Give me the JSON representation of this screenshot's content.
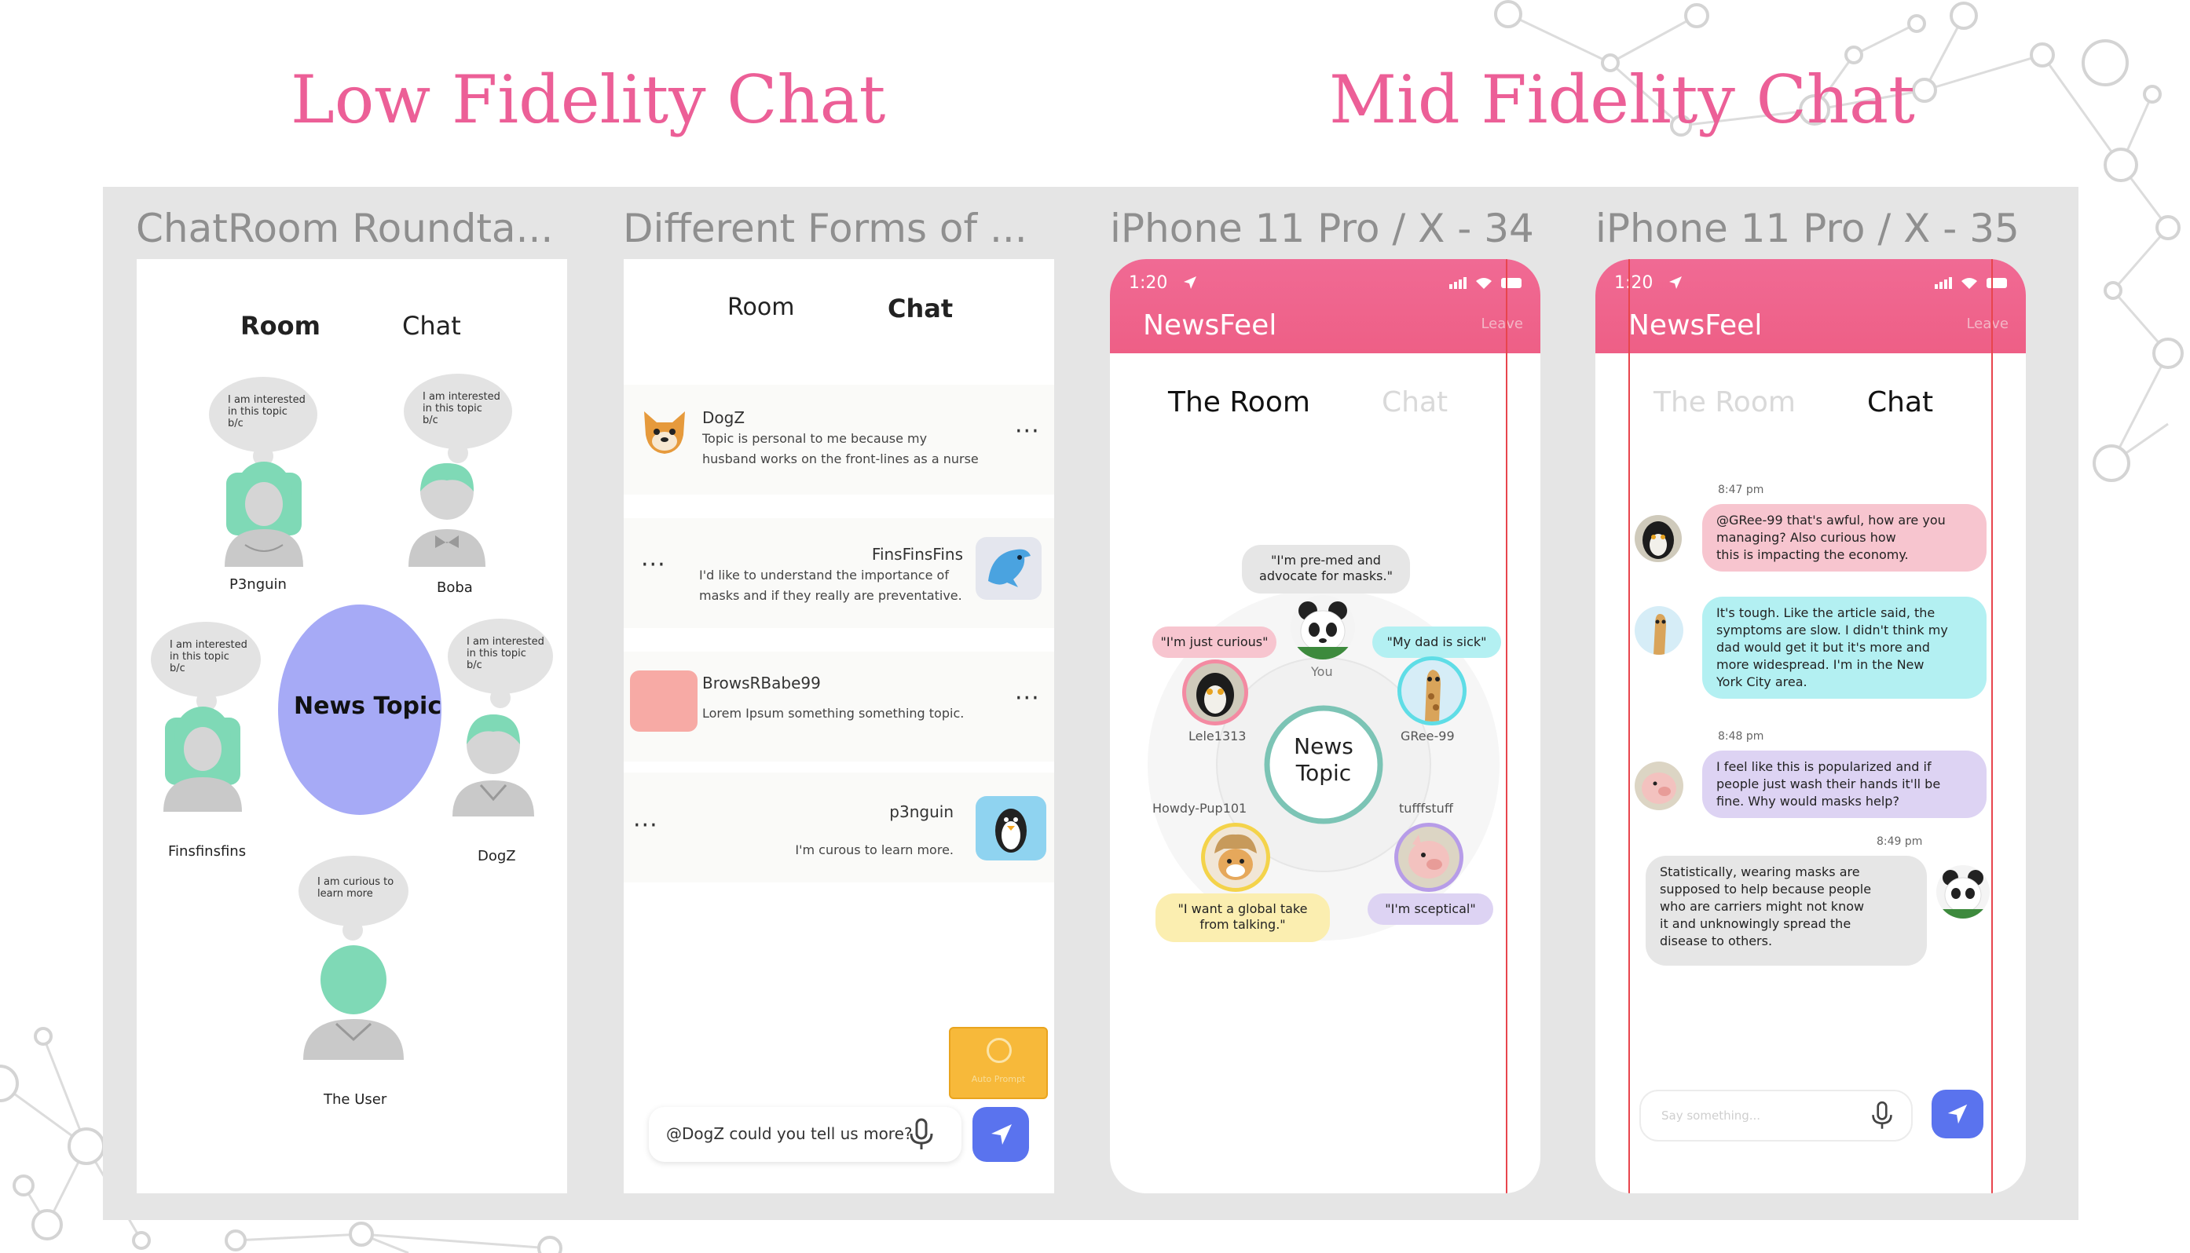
{
  "titles": {
    "low": "Low Fidelity Chat",
    "mid": "Mid Fidelity Chat"
  },
  "frames": {
    "f1": "ChatRoom Roundta...",
    "f2": "Different Forms of ...",
    "f3": "iPhone 11 Pro / X - 34",
    "f4": "iPhone 11 Pro / X - 35"
  },
  "lowfi_room": {
    "tab_room": "Room",
    "tab_chat": "Chat",
    "bubble_interest": "I am interested\nin this topic\nb/c",
    "bubble_interest_alt": "I am interested\nin this topic\nb/c",
    "bubble_curious": "I am curious to\nlearn more",
    "users": [
      "P3nguin",
      "Boba",
      "Finsfinsfins",
      "DogZ",
      "The User"
    ],
    "center": "News Topic",
    "colors": {
      "avatar": "#7fd9b6",
      "center": "#a6aaf6",
      "body": "#c9c9c9"
    }
  },
  "lowfi_chat": {
    "tab_room": "Room",
    "tab_chat": "Chat",
    "messages": [
      {
        "user": "DogZ",
        "text": "Topic is personal to me because my\nhusband works on the front-lines as a nurse",
        "icon": "dog-icon"
      },
      {
        "user": "FinsFinsFins",
        "text": "I'd like to understand the importance of\nmasks and if they really are preventative.",
        "icon": "dolphin-icon"
      },
      {
        "user": "BrowsRBabe99",
        "text": "Lorem Ipsum something something topic.",
        "icon": "pink-avatar"
      },
      {
        "user": "p3nguin",
        "text": "I'm curous to learn more.",
        "icon": "penguin-icon"
      }
    ],
    "auto_prompt": "Auto Prompt",
    "input_value": "@DogZ could you tell us more?"
  },
  "phone": {
    "time": "1:20",
    "brand": "NewsFeel",
    "leave": "Leave"
  },
  "room_view": {
    "tab_room": "The Room",
    "tab_chat": "Chat",
    "center": "News\nTopic",
    "quotes": {
      "you": "\"I'm pre-med and\nadvocate for masks.\"",
      "lele": "\"I'm just curious\"",
      "gree": "\"My dad is sick\"",
      "howdy": "\"I want a global take\nfrom talking.\"",
      "tuff": "\"I'm sceptical\""
    },
    "names": {
      "you": "You",
      "lele": "Lele1313",
      "gree": "GRee-99",
      "howdy": "Howdy-Pup101",
      "tuff": "tufffstuff"
    },
    "colors": {
      "pink": "#f7c5cf",
      "cyan": "#b3f0f2",
      "yellow": "#fbeeb0",
      "purple": "#ddd3f3",
      "ring": "#7cc4b5"
    }
  },
  "chat_view": {
    "tab_room": "The Room",
    "tab_chat": "Chat",
    "messages": [
      {
        "time": "8:47 pm",
        "text": "@GRee-99 that's awful, how are you\nmanaging? Also curious how\nthis is impacting the economy.",
        "color": "#f7c5cf",
        "icon": "lemur-avatar"
      },
      {
        "time": "",
        "text": "It's tough. Like the article said, the\nsymptoms are slow. I didn't think my\ndad would get it but it's more and\nmore widespread. I'm in the New\nYork City area.",
        "color": "#b3f0f2",
        "icon": "giraffe-avatar"
      },
      {
        "time": "8:48 pm",
        "text": "I feel like this is popularized and if\npeople just wash their hands it'll be\nfine. Why would masks help?",
        "color": "#ddd3f3",
        "icon": "pig-avatar"
      },
      {
        "time": "8:49 pm",
        "text": "Statistically, wearing masks are\nsupposed to help because people\nwho are carriers might not know\nit and unknowingly spread the\ndisease to others.",
        "color": "#e6e6e6",
        "icon": "panda-avatar"
      }
    ],
    "input_placeholder": "Say something..."
  }
}
